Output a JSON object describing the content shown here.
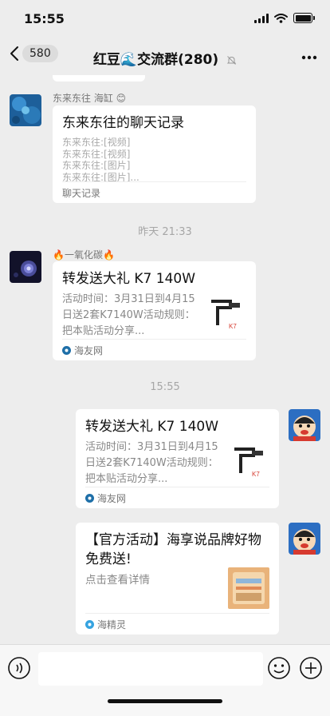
{
  "status": {
    "time": "15:55"
  },
  "header": {
    "back_count": "580",
    "title": "红豆🌊交流群(280)"
  },
  "messages": {
    "m1": {
      "sender": "东来东往 海缸 😊",
      "card_title": "东来东往的聊天记录",
      "lines": [
        "东来东往:[视频]",
        "东来东往:[视频]",
        "东来东往:[图片]",
        "东来东往:[图片]..."
      ],
      "footer": "聊天记录"
    },
    "ts1": "昨天 21:33",
    "m2": {
      "sender": "🔥一氧化碳🔥",
      "card_title": "转发送大礼 K7 140W",
      "desc": "活动时间：3月31日到4月15日送2套K7140W活动规则：把本贴活动分享...",
      "source": "海友网"
    },
    "ts2": "15:55",
    "m3": {
      "card_title": "转发送大礼 K7 140W",
      "desc": "活动时间：3月31日到4月15日送2套K7140W活动规则：把本贴活动分享...",
      "source": "海友网"
    },
    "m4": {
      "card_title": "【官方活动】海享说品牌好物免费送!",
      "desc": "点击查看详情",
      "source": "海精灵"
    }
  },
  "colors": {
    "background": "#ededed",
    "card": "#ffffff",
    "app_icon": "#1e6fa8",
    "accent_red": "#d63a2f"
  }
}
